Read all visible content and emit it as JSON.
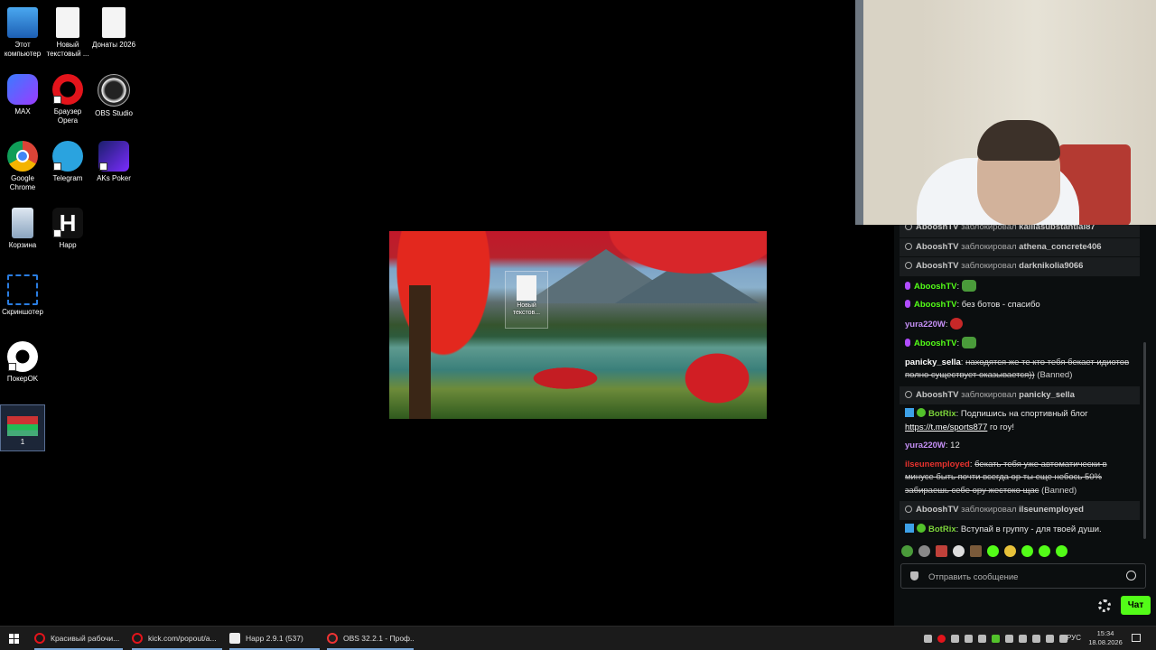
{
  "desktop": {
    "icons": [
      {
        "label": "Этот компьютер",
        "icon": "computer-icon"
      },
      {
        "label": "Новый текстовый ...",
        "icon": "text-file-icon"
      },
      {
        "label": "Донаты 2026",
        "icon": "text-file-icon"
      },
      {
        "label": "MAX",
        "icon": "max-messenger-icon"
      },
      {
        "label": "Браузер Opera",
        "icon": "opera-icon"
      },
      {
        "label": "OBS Studio",
        "icon": "obs-icon"
      },
      {
        "label": "Google Chrome",
        "icon": "chrome-icon"
      },
      {
        "label": "Telegram",
        "icon": "telegram-icon"
      },
      {
        "label": "AKs Poker",
        "icon": "aks-poker-icon"
      },
      {
        "label": "Корзина",
        "icon": "recycle-bin-icon"
      },
      {
        "label": "Happ",
        "icon": "happ-icon"
      },
      {
        "label": "Скриншотер",
        "icon": "screenshot-icon"
      },
      {
        "label": "ПокерOK",
        "icon": "pokerok-icon"
      }
    ],
    "selected_item_label": "1"
  },
  "wallpaper_preview": {
    "file_label": "Новый текстов..."
  },
  "chat": {
    "messages": [
      {
        "type": "mod",
        "user": "AbooshTV",
        "action": "заблокировал",
        "target": "kailiasubstantial87"
      },
      {
        "type": "mod",
        "user": "AbooshTV",
        "action": "заблокировал",
        "target": "athena_concrete406"
      },
      {
        "type": "mod",
        "user": "AbooshTV",
        "action": "заблокировал",
        "target": "darknikolia9066"
      },
      {
        "type": "msg",
        "user": "AbooshTV",
        "text": ""
      },
      {
        "type": "msg",
        "user": "AbooshTV",
        "text": "без ботов - спасибо"
      },
      {
        "type": "msg",
        "user": "yura220W",
        "text": ""
      },
      {
        "type": "msg",
        "user": "AbooshTV",
        "text": ""
      },
      {
        "type": "banned",
        "user": "panicky_sella",
        "text": "находятся же те кто тебя бекает идиотов полно существует оказывается))",
        "suffix": "(Banned)"
      },
      {
        "type": "mod",
        "user": "AbooshTV",
        "action": "заблокировал",
        "target": "panicky_sella"
      },
      {
        "type": "bot",
        "user": "BotRix",
        "text": "Подпишись на спортивный блог",
        "link": "https://t.me/sports877",
        "text2": "го гоу!"
      },
      {
        "type": "msg",
        "user": "yura220W",
        "text": "12"
      },
      {
        "type": "banned",
        "user": "ilseunemployed",
        "text": "бекать тебя уже автоматически в минусе быть почти всегда ор ты еще небось 50% забираешь себе ору жестоко щас",
        "suffix": "(Banned)"
      },
      {
        "type": "mod",
        "user": "AbooshTV",
        "action": "заблокировал",
        "target": "ilseunemployed"
      },
      {
        "type": "bot",
        "user": "BotRix",
        "text": "Вступай в группу - для твоей души."
      }
    ],
    "input_placeholder": "Отправить сообщение",
    "send_label": "Чат"
  },
  "taskbar": {
    "tasks": [
      {
        "label": "Красивый рабочи...",
        "icon": "opera-icon"
      },
      {
        "label": "kick.com/popout/a...",
        "icon": "opera-icon"
      },
      {
        "label": "Happ 2.9.1 (537)",
        "icon": "happ-icon"
      },
      {
        "label": "OBS 32.2.1 - Проф...",
        "icon": "obs-icon"
      }
    ],
    "language": "РУС",
    "time": "15:34",
    "date": "18.08.2026"
  }
}
